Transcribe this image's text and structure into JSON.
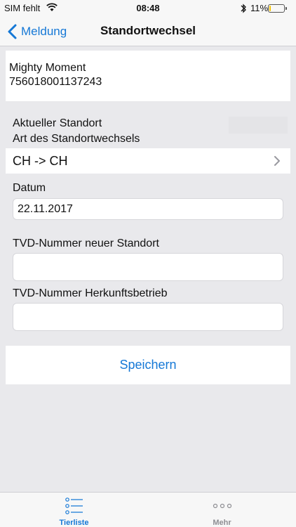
{
  "status_bar": {
    "carrier": "SIM fehlt",
    "time": "08:48",
    "battery_percent": "11%",
    "battery_level": 0.11
  },
  "nav": {
    "back_label": "Meldung",
    "title": "Standortwechsel"
  },
  "animal": {
    "name": "Mighty Moment",
    "tvd_number": "756018001137243"
  },
  "form": {
    "aktueller_standort_label": "Aktueller Standort",
    "art_label": "Art des Standortwechsels",
    "art_value": "CH -> CH",
    "datum_label": "Datum",
    "datum_value": "22.11.2017",
    "tvd_neu_label": "TVD-Nummer neuer Standort",
    "tvd_neu_value": "",
    "tvd_herkunft_label": "TVD-Nummer Herkunftsbetrieb",
    "tvd_herkunft_value": ""
  },
  "actions": {
    "save_label": "Speichern"
  },
  "tabs": [
    {
      "label": "Tierliste",
      "icon": "list-icon",
      "active": true
    },
    {
      "label": "Mehr",
      "icon": "more-icon",
      "active": false
    }
  ],
  "colors": {
    "accent": "#1578d6",
    "background": "#e9e9ec",
    "battery_low": "#f5c400"
  }
}
